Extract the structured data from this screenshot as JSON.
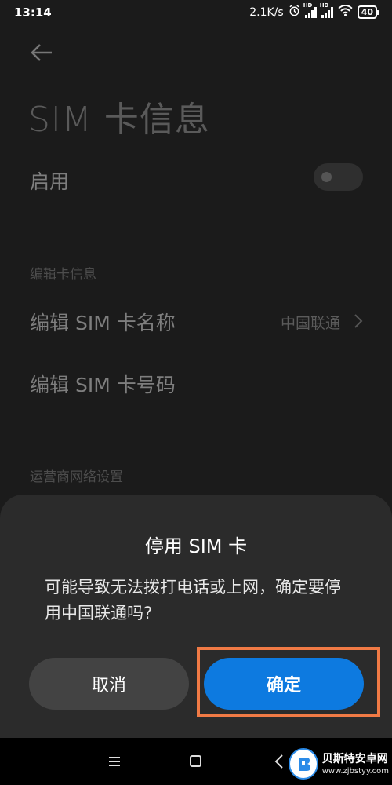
{
  "status_bar": {
    "time": "13:14",
    "network_speed": "2.1K/s",
    "signal_tag": "HD",
    "battery": "40"
  },
  "page": {
    "title": "SIM 卡信息",
    "enable_label": "启用",
    "enable_toggle_on": false,
    "section_edit": "编辑卡信息",
    "edit_name_label": "编辑 SIM 卡名称",
    "edit_name_value": "中国联通",
    "edit_number_label": "编辑 SIM 卡号码",
    "section_carrier": "运营商网络设置"
  },
  "dialog": {
    "title": "停用 SIM 卡",
    "message": "可能导致无法拨打电话或上网，确定要停用中国联通吗?",
    "cancel_label": "取消",
    "confirm_label": "确定"
  },
  "colors": {
    "confirm_button": "#0d7ae0",
    "highlight_box": "#f07a45"
  },
  "watermark": {
    "title": "贝斯特安卓网",
    "url": "www.zjbstyy.com"
  }
}
